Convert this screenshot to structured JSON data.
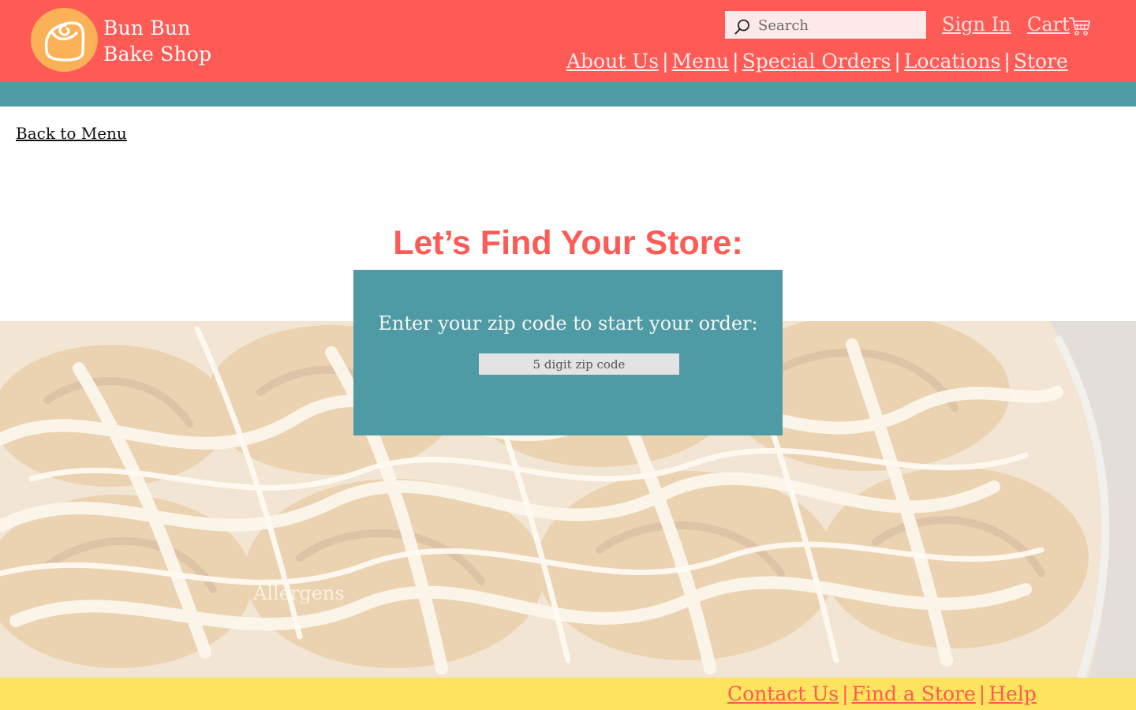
{
  "brand": {
    "line1": "Bun Bun",
    "line2": "Bake Shop"
  },
  "header": {
    "search_placeholder": "Search",
    "sign_in": "Sign In",
    "cart": "Cart"
  },
  "nav": [
    "About Us",
    "Menu",
    "Special Orders",
    "Locations",
    "Store"
  ],
  "nav_separator": "|",
  "back_link": "Back to Menu",
  "main": {
    "title": "Let’s Find Your Store:",
    "prompt": "Enter your zip code to start your order:",
    "zip_placeholder": "5 digit zip code"
  },
  "hero_faded_text": "Allergens",
  "footer": [
    "Contact Us",
    "Find a Store",
    "Help"
  ],
  "colors": {
    "header_red": "#fe5a56",
    "teal": "#4f9ba5",
    "logo_orange": "#fbb155",
    "footer_yellow": "#fee35f"
  },
  "icons": [
    "cinnamon-bun-logo-icon",
    "search-icon",
    "cart-icon"
  ]
}
